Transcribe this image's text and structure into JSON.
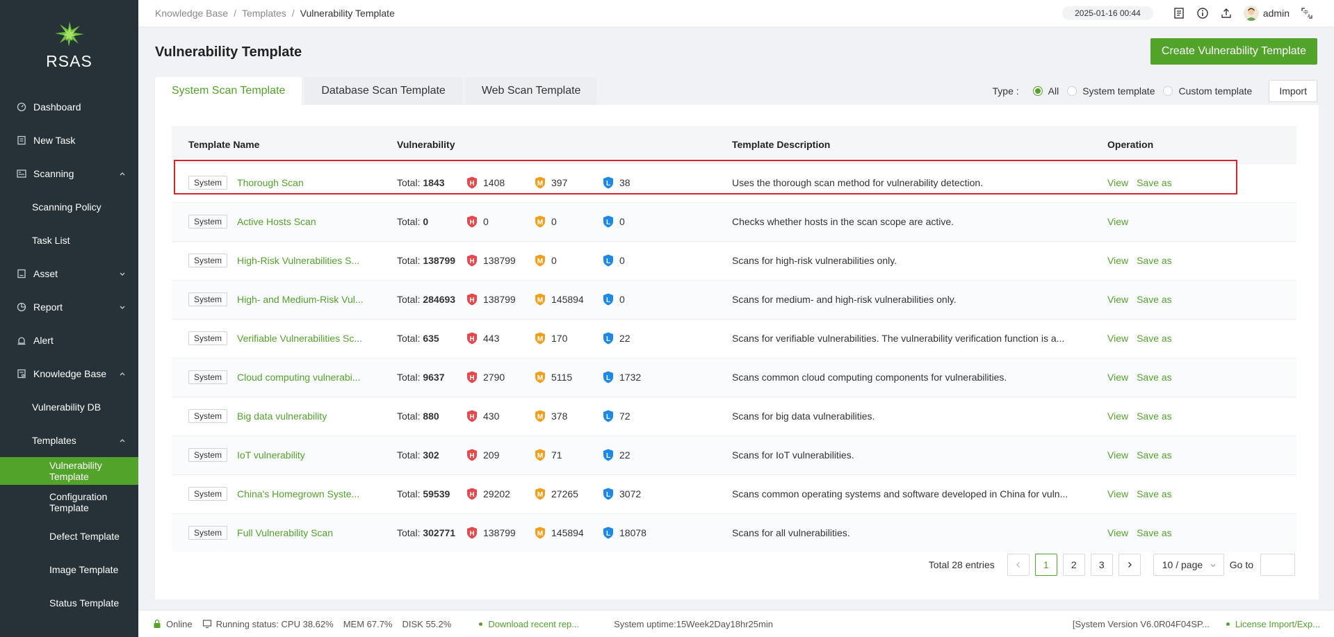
{
  "app": {
    "brand": "RSAS"
  },
  "sidebar": {
    "items": [
      {
        "label": "Dashboard",
        "icon": "dashboard-icon"
      },
      {
        "label": "New Task",
        "icon": "new-task-icon"
      },
      {
        "label": "Scanning",
        "icon": "scanning-icon"
      },
      {
        "label": "Scanning Policy"
      },
      {
        "label": "Task List"
      },
      {
        "label": "Asset",
        "icon": "asset-icon"
      },
      {
        "label": "Report",
        "icon": "report-icon"
      },
      {
        "label": "Alert",
        "icon": "alert-icon"
      },
      {
        "label": "Knowledge Base",
        "icon": "knowledge-base-icon"
      },
      {
        "label": "Vulnerability DB"
      },
      {
        "label": "Templates"
      },
      {
        "label": "Vulnerability Template"
      },
      {
        "label": "Configuration Template"
      },
      {
        "label": "Defect Template"
      },
      {
        "label": "Image Template"
      },
      {
        "label": "Status Template"
      }
    ]
  },
  "header": {
    "breadcrumb": [
      "Knowledge Base",
      "Templates",
      "Vulnerability Template"
    ],
    "datetime": "2025-01-16 00:44",
    "user": "admin"
  },
  "main": {
    "title": "Vulnerability Template",
    "create_label": "Create Vulnerability Template",
    "tabs": [
      {
        "label": "System Scan Template"
      },
      {
        "label": "Database Scan Template"
      },
      {
        "label": "Web Scan Template"
      }
    ],
    "filter": {
      "label": "Type :",
      "options": [
        "All",
        "System template",
        "Custom template"
      ],
      "selected": "All"
    },
    "import_label": "Import",
    "columns": [
      "Template Name",
      "Vulnerability",
      "Template Description",
      "Operation"
    ],
    "total_label": "Total:",
    "badge_letters": {
      "high": "H",
      "medium": "M",
      "low": "L"
    },
    "actions": {
      "view": "View",
      "save_as": "Save as"
    },
    "rows": [
      {
        "tag": "System",
        "name": "Thorough Scan",
        "total": "1843",
        "high": "1408",
        "medium": "397",
        "low": "38",
        "desc": "Uses the thorough scan method for vulnerability detection.",
        "save_as": true
      },
      {
        "tag": "System",
        "name": "Active Hosts Scan",
        "total": "0",
        "high": "0",
        "medium": "0",
        "low": "0",
        "desc": "Checks whether hosts in the scan scope are active.",
        "save_as": false
      },
      {
        "tag": "System",
        "name": "High-Risk Vulnerabilities S...",
        "total": "138799",
        "high": "138799",
        "medium": "0",
        "low": "0",
        "desc": "Scans for high-risk vulnerabilities only.",
        "save_as": true
      },
      {
        "tag": "System",
        "name": "High- and Medium-Risk Vul...",
        "total": "284693",
        "high": "138799",
        "medium": "145894",
        "low": "0",
        "desc": "Scans for medium- and high-risk vulnerabilities only.",
        "save_as": true
      },
      {
        "tag": "System",
        "name": "Verifiable Vulnerabilities Sc...",
        "total": "635",
        "high": "443",
        "medium": "170",
        "low": "22",
        "desc": "Scans for verifiable vulnerabilities. The vulnerability verification function is a...",
        "save_as": true
      },
      {
        "tag": "System",
        "name": "Cloud computing vulnerabi...",
        "total": "9637",
        "high": "2790",
        "medium": "5115",
        "low": "1732",
        "desc": "Scans common cloud computing components for vulnerabilities.",
        "save_as": true
      },
      {
        "tag": "System",
        "name": "Big data vulnerability",
        "total": "880",
        "high": "430",
        "medium": "378",
        "low": "72",
        "desc": "Scans for big data vulnerabilities.",
        "save_as": true
      },
      {
        "tag": "System",
        "name": "IoT vulnerability",
        "total": "302",
        "high": "209",
        "medium": "71",
        "low": "22",
        "desc": "Scans for IoT vulnerabilities.",
        "save_as": true
      },
      {
        "tag": "System",
        "name": "China's Homegrown Syste...",
        "total": "59539",
        "high": "29202",
        "medium": "27265",
        "low": "3072",
        "desc": "Scans common operating systems and software developed in China for vuln...",
        "save_as": true
      },
      {
        "tag": "System",
        "name": "Full Vulnerability Scan",
        "total": "302771",
        "high": "138799",
        "medium": "145894",
        "low": "18078",
        "desc": "Scans for all vulnerabilities.",
        "save_as": true
      }
    ],
    "pagination": {
      "total": "Total 28 entries",
      "pages": [
        "1",
        "2",
        "3"
      ],
      "current": "1",
      "page_size": "10 / page",
      "goto": "Go to"
    }
  },
  "footer": {
    "online": "Online",
    "running": "Running status: CPU 38.62%",
    "mem": "MEM 67.7%",
    "disk": "DISK 55.2%",
    "download": "Download recent rep...",
    "uptime": "System uptime:15Week2Day18hr25min",
    "version": "[System Version V6.0R04F04SP...",
    "license": "License Import/Exp..."
  },
  "colors": {
    "accent": "#52a32a",
    "sidebar": "#263238",
    "high": "#e5484d",
    "medium": "#f0a020",
    "low": "#1e88e5",
    "highlight": "#d9232d"
  }
}
